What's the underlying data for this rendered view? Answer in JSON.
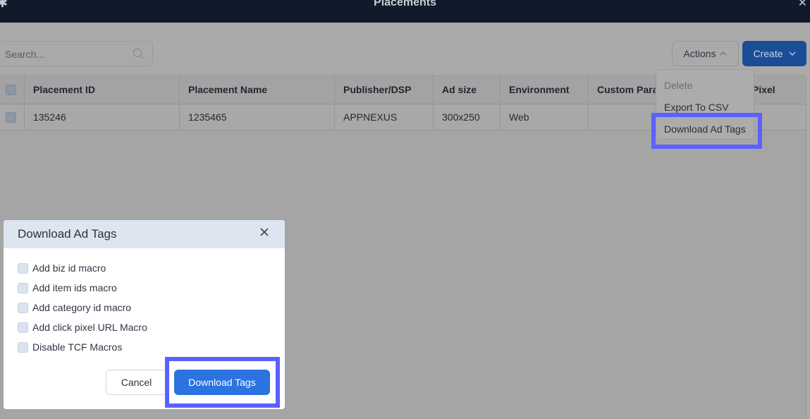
{
  "window": {
    "title": "Placements"
  },
  "search": {
    "placeholder": "Search..."
  },
  "toolbar": {
    "actions_label": "Actions",
    "create_label": "Create"
  },
  "table": {
    "columns": [
      "Placement ID",
      "Placement Name",
      "Publisher/DSP",
      "Ad size",
      "Environment",
      "Custom Para",
      "Pixel"
    ],
    "rows": [
      [
        "135246",
        "1235465",
        "APPNEXUS",
        "300x250",
        "Web"
      ]
    ]
  },
  "actions_menu": {
    "items": [
      "Delete",
      "Export To CSV",
      "Download Ad Tags"
    ]
  },
  "modal": {
    "title": "Download Ad Tags",
    "options": [
      "Add biz id macro",
      "Add item ids macro",
      "Add category id macro",
      "Add click pixel URL Macro",
      "Disable TCF Macros"
    ],
    "cancel_label": "Cancel",
    "download_label": "Download Tags"
  },
  "colors": {
    "accent": "#2b73e0",
    "highlight": "#5b61ff",
    "topbar": "#101a2b"
  }
}
